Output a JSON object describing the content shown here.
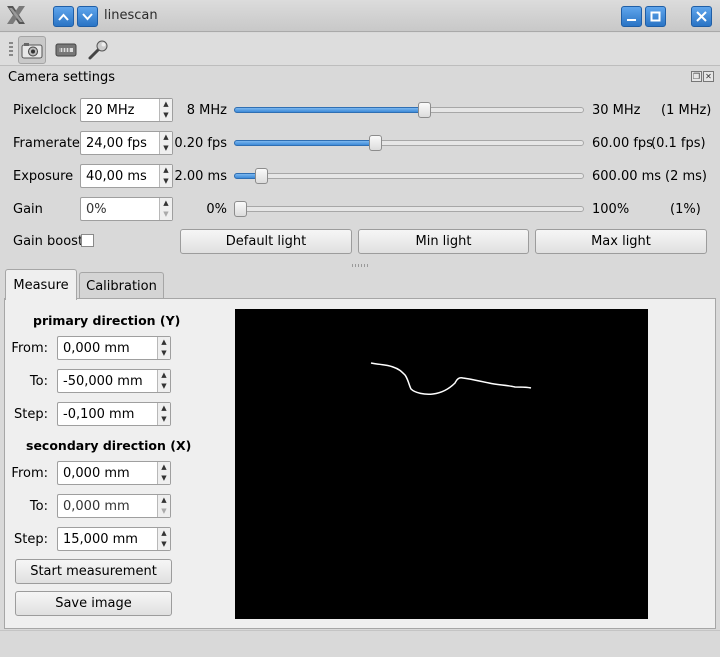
{
  "window": {
    "title": "linescan",
    "app_icon": "x-logo-icon",
    "controls": [
      "chevron-up-icon",
      "chevron-down-icon",
      "minimize-icon",
      "maximize-icon",
      "close-icon"
    ]
  },
  "toolbar": {
    "tools": [
      {
        "icon": "camera-icon",
        "active": true
      },
      {
        "icon": "device-icon",
        "active": false
      },
      {
        "icon": "wrench-icon",
        "active": false
      }
    ]
  },
  "camera_settings": {
    "title": "Camera settings",
    "rows": [
      {
        "label": "Pixelclock",
        "value": "20 MHz",
        "min": "8 MHz",
        "max": "30 MHz",
        "step": "(1 MHz)",
        "fraction": 0.545
      },
      {
        "label": "Framerate",
        "value": "24,00 fps",
        "min": "0.20 fps",
        "max": "60.00 fps",
        "step": "(0.1 fps)",
        "fraction": 0.4
      },
      {
        "label": "Exposure",
        "value": "40,00 ms",
        "min": "2.00 ms",
        "max": "600.00 ms",
        "step": "(2 ms)",
        "fraction": 0.063
      },
      {
        "label": "Gain",
        "value": "0%",
        "min": "0%",
        "max": "100%",
        "step": "(1%)",
        "fraction": 0.0
      }
    ],
    "gain_boost_label": "Gain boost",
    "gain_boost_checked": false,
    "buttons": {
      "default_light": "Default light",
      "min_light": "Min light",
      "max_light": "Max light"
    }
  },
  "tabs": [
    {
      "label": "Measure",
      "active": true
    },
    {
      "label": "Calibration",
      "active": false
    }
  ],
  "measure": {
    "primary": {
      "heading": "primary direction (Y)",
      "from_label": "From:",
      "from_value": "0,000 mm",
      "to_label": "To:",
      "to_value": "-50,000 mm",
      "step_label": "Step:",
      "step_value": "-0,100 mm"
    },
    "secondary": {
      "heading": "secondary direction (X)",
      "from_label": "From:",
      "from_value": "0,000 mm",
      "to_label": "To:",
      "to_value": "0,000 mm",
      "step_label": "Step:",
      "step_value": "15,000 mm"
    },
    "start_button": "Start measurement",
    "save_button": "Save image"
  },
  "colors": {
    "accent": "#3d8ad8",
    "title_button": "#2a74c5",
    "window_bg": "#d9d9d9",
    "preview_bg": "#000000"
  }
}
